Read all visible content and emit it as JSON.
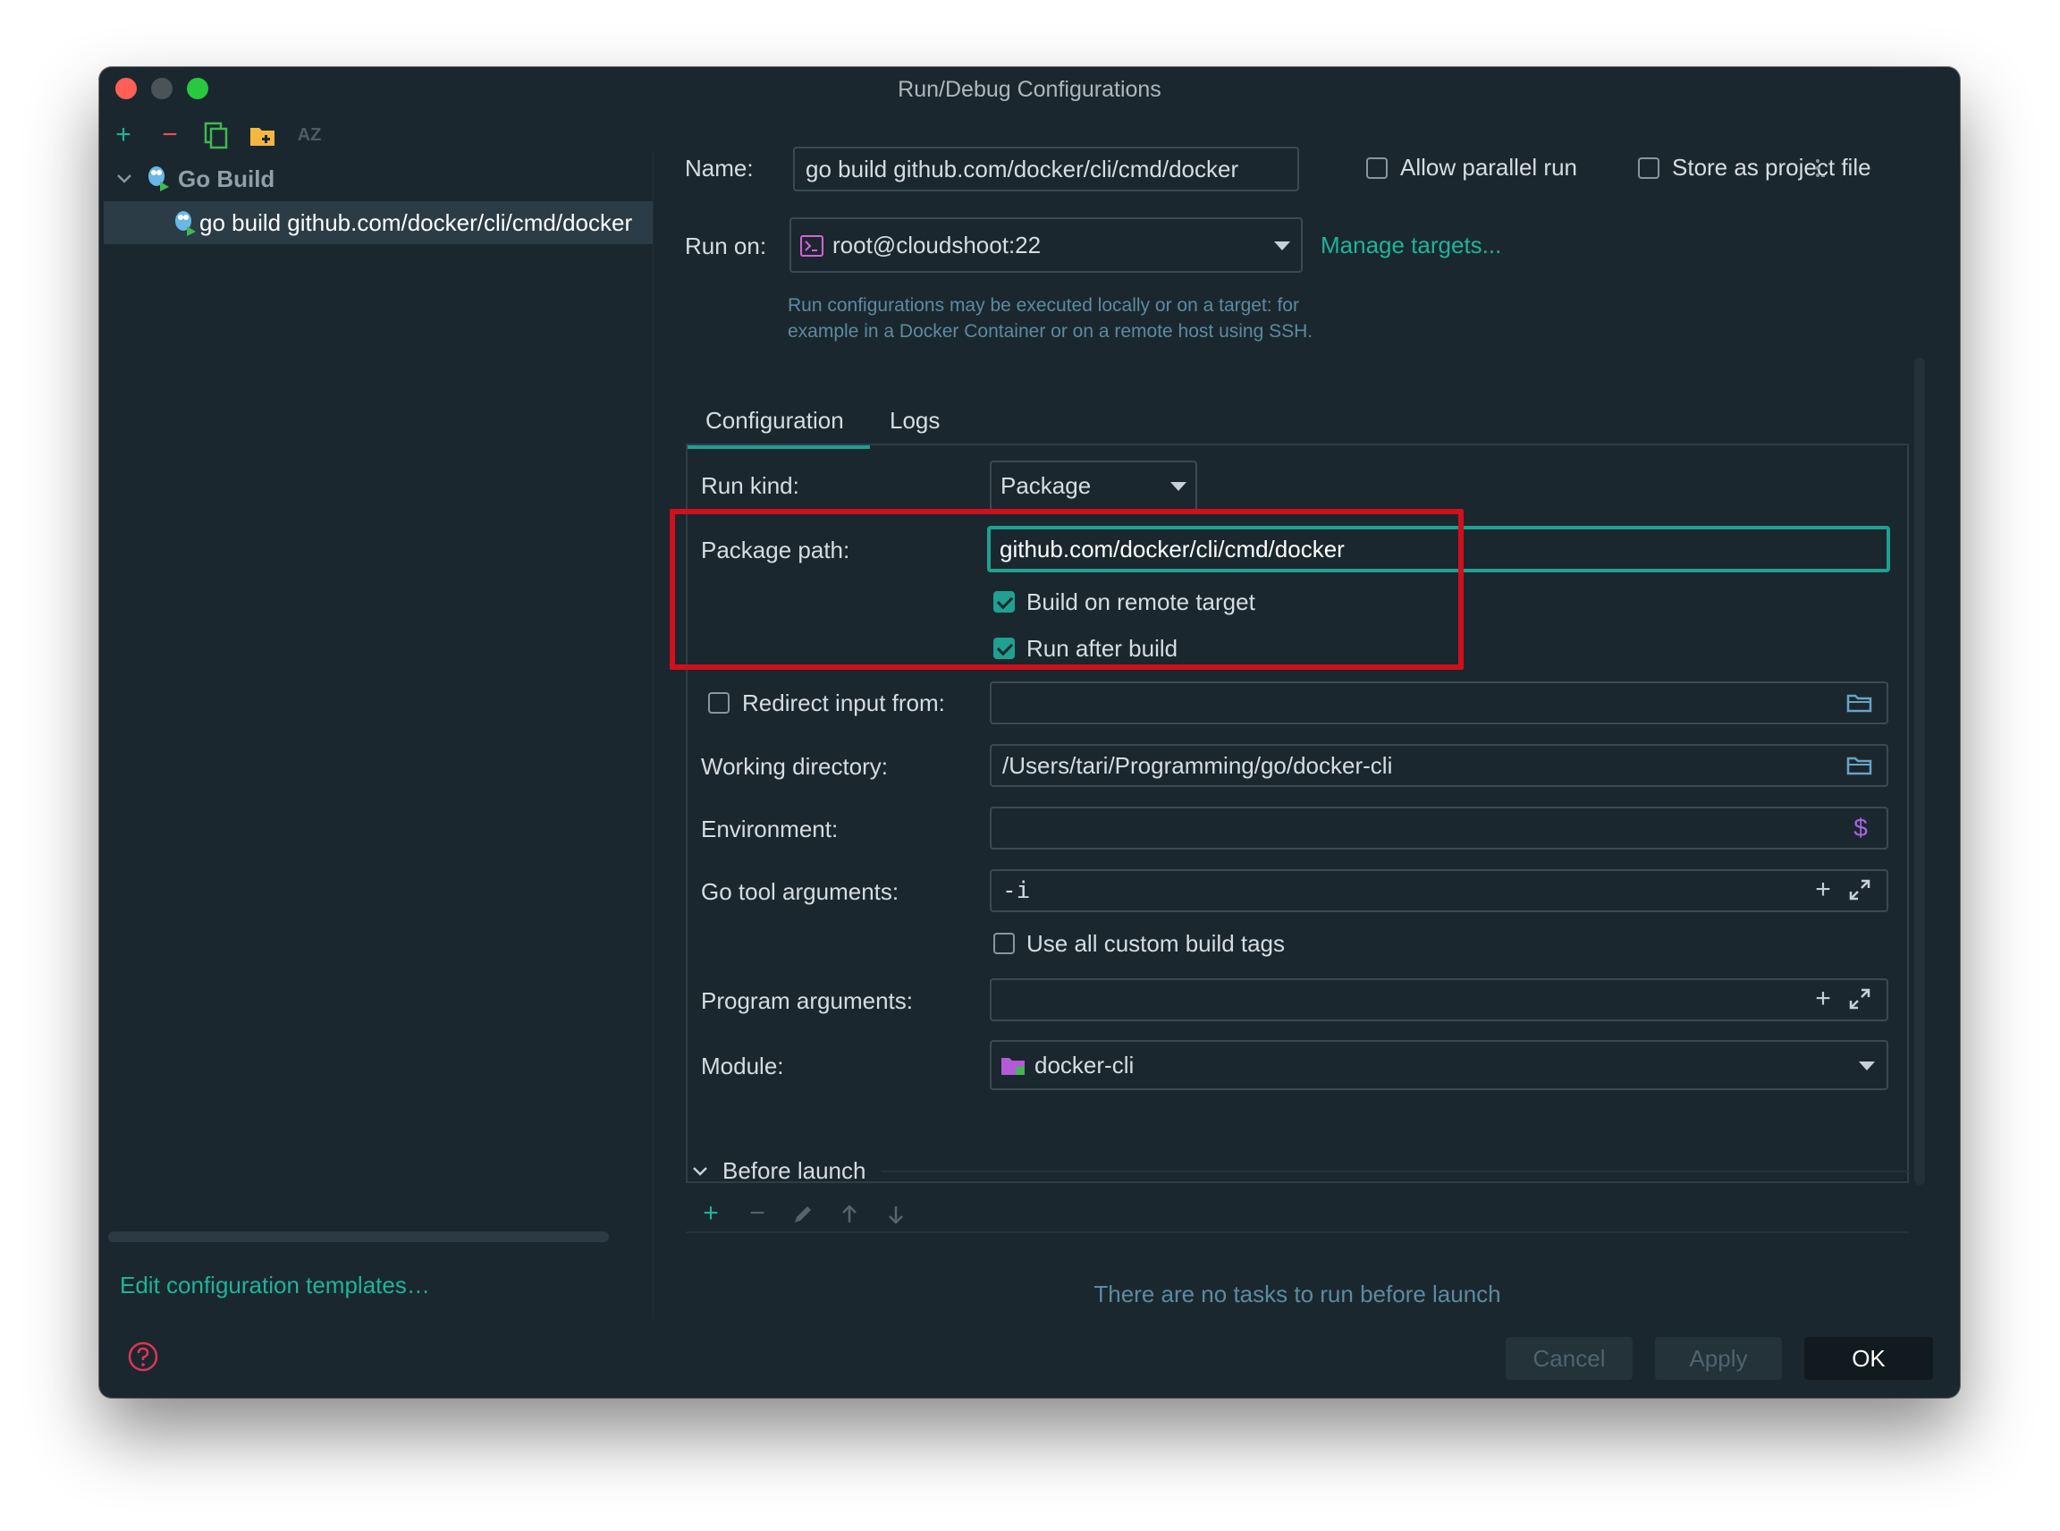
{
  "window": {
    "title": "Run/Debug Configurations"
  },
  "colors": {
    "accent": "#1fa090",
    "highlight_box": "#d0101c",
    "close": "#fe5f57",
    "minimize": "#4a5358",
    "maximize": "#28c840",
    "folder_yellow": "#f4b840",
    "remove_red": "#e45454"
  },
  "sidebar": {
    "toolbar_icons": [
      "add-icon",
      "remove-icon",
      "copy-icon",
      "new-folder-icon",
      "sort-alphabetically-icon"
    ],
    "sort_label": "AZ",
    "tree": {
      "group_label": "Go Build",
      "item_label": "go build github.com/docker/cli/cmd/docker"
    },
    "edit_templates_link": "Edit configuration templates…"
  },
  "header": {
    "name_label": "Name:",
    "name_value": "go build github.com/docker/cli/cmd/docker",
    "allow_parallel_label": "Allow parallel run",
    "allow_parallel_checked": false,
    "store_as_project_label": "Store as project file",
    "store_as_project_checked": false,
    "run_on_label": "Run on:",
    "run_on_value": "root@cloudshoot:22",
    "manage_targets_link": "Manage targets...",
    "run_on_hint_line1": "Run configurations may be executed locally or on a target: for",
    "run_on_hint_line2": "example in a Docker Container or on a remote host using SSH."
  },
  "tabs": [
    {
      "label": "Configuration",
      "active": true
    },
    {
      "label": "Logs",
      "active": false
    }
  ],
  "config": {
    "run_kind_label": "Run kind:",
    "run_kind_value": "Package",
    "package_path_label": "Package path:",
    "package_path_value": "github.com/docker/cli/cmd/docker",
    "build_on_remote_label": "Build on remote target",
    "build_on_remote_checked": true,
    "run_after_build_label": "Run after build",
    "run_after_build_checked": true,
    "redirect_input_label": "Redirect input from:",
    "redirect_input_checked": false,
    "redirect_input_value": "",
    "working_dir_label": "Working directory:",
    "working_dir_value": "/Users/tari/Programming/go/docker-cli",
    "environment_label": "Environment:",
    "environment_value": "",
    "environment_icon_glyph": "$",
    "go_tool_args_label": "Go tool arguments:",
    "go_tool_args_value": "-i",
    "use_custom_tags_label": "Use all custom build tags",
    "use_custom_tags_checked": false,
    "program_args_label": "Program arguments:",
    "program_args_value": "",
    "module_label": "Module:",
    "module_value": "docker-cli"
  },
  "before_launch": {
    "title": "Before launch",
    "empty_text": "There are no tasks to run before launch",
    "toolbar_icons": [
      "add-icon",
      "remove-icon",
      "edit-icon",
      "move-up-icon",
      "move-down-icon"
    ]
  },
  "footer": {
    "cancel_label": "Cancel",
    "apply_label": "Apply",
    "ok_label": "OK"
  }
}
